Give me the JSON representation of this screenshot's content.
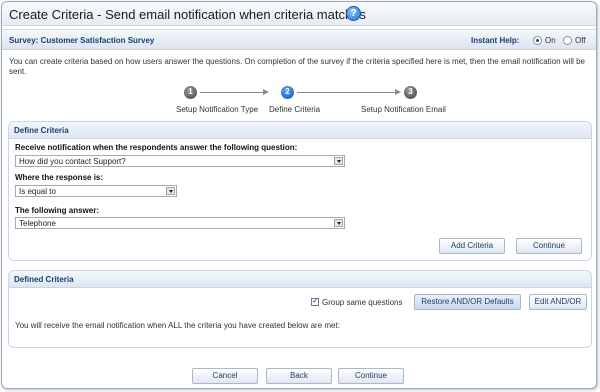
{
  "header": {
    "title": "Create Criteria - Send email notification when criteria matches",
    "help_icon": "question-circle-icon"
  },
  "survey_bar": {
    "label": "Survey: Customer Satisfaction Survey",
    "instant_help_label": "Instant Help:",
    "on_label": "On",
    "off_label": "Off",
    "selected": "On"
  },
  "intro": "You can create criteria based on how users answer the questions. On completion of the survey if the criteria specified here is met, then the email notification will be sent.",
  "steps": [
    {
      "number": "1",
      "label": "Setup Notification Type"
    },
    {
      "number": "2",
      "label": "Define Criteria"
    },
    {
      "number": "3",
      "label": "Setup Notification Email"
    }
  ],
  "define_criteria": {
    "title": "Define Criteria",
    "question_label": "Receive notification when the respondents answer the following question:",
    "question_value": "How did you contact Support?",
    "response_label": "Where the response is:",
    "response_value": "Is equal to",
    "answer_label": "The following answer:",
    "answer_value": "Telephone",
    "add_button": "Add Criteria",
    "continue_button": "Continue"
  },
  "defined_criteria": {
    "title": "Defined Criteria",
    "group_label": "Group same questions",
    "group_checked": true,
    "restore_button": "Restore AND/OR Defaults",
    "edit_button": "Edit AND/OR",
    "note": "You will receive the email notification when ALL the criteria you have created below are met:"
  },
  "footer": {
    "cancel": "Cancel",
    "back": "Back",
    "continue": "Continue"
  },
  "colors": {
    "accent": "#1b3f6e",
    "active_step": "#0d4fb2"
  }
}
